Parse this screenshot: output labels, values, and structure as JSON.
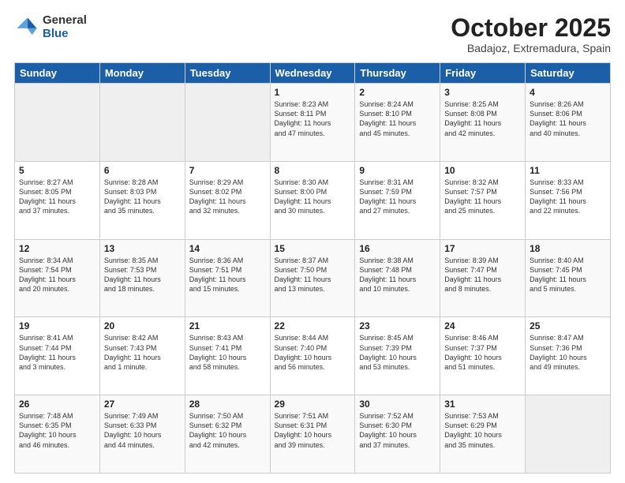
{
  "header": {
    "logo_general": "General",
    "logo_blue": "Blue",
    "month": "October 2025",
    "location": "Badajoz, Extremadura, Spain"
  },
  "weekdays": [
    "Sunday",
    "Monday",
    "Tuesday",
    "Wednesday",
    "Thursday",
    "Friday",
    "Saturday"
  ],
  "weeks": [
    [
      {
        "day": "",
        "info": ""
      },
      {
        "day": "",
        "info": ""
      },
      {
        "day": "",
        "info": ""
      },
      {
        "day": "1",
        "info": "Sunrise: 8:23 AM\nSunset: 8:11 PM\nDaylight: 11 hours\nand 47 minutes."
      },
      {
        "day": "2",
        "info": "Sunrise: 8:24 AM\nSunset: 8:10 PM\nDaylight: 11 hours\nand 45 minutes."
      },
      {
        "day": "3",
        "info": "Sunrise: 8:25 AM\nSunset: 8:08 PM\nDaylight: 11 hours\nand 42 minutes."
      },
      {
        "day": "4",
        "info": "Sunrise: 8:26 AM\nSunset: 8:06 PM\nDaylight: 11 hours\nand 40 minutes."
      }
    ],
    [
      {
        "day": "5",
        "info": "Sunrise: 8:27 AM\nSunset: 8:05 PM\nDaylight: 11 hours\nand 37 minutes."
      },
      {
        "day": "6",
        "info": "Sunrise: 8:28 AM\nSunset: 8:03 PM\nDaylight: 11 hours\nand 35 minutes."
      },
      {
        "day": "7",
        "info": "Sunrise: 8:29 AM\nSunset: 8:02 PM\nDaylight: 11 hours\nand 32 minutes."
      },
      {
        "day": "8",
        "info": "Sunrise: 8:30 AM\nSunset: 8:00 PM\nDaylight: 11 hours\nand 30 minutes."
      },
      {
        "day": "9",
        "info": "Sunrise: 8:31 AM\nSunset: 7:59 PM\nDaylight: 11 hours\nand 27 minutes."
      },
      {
        "day": "10",
        "info": "Sunrise: 8:32 AM\nSunset: 7:57 PM\nDaylight: 11 hours\nand 25 minutes."
      },
      {
        "day": "11",
        "info": "Sunrise: 8:33 AM\nSunset: 7:56 PM\nDaylight: 11 hours\nand 22 minutes."
      }
    ],
    [
      {
        "day": "12",
        "info": "Sunrise: 8:34 AM\nSunset: 7:54 PM\nDaylight: 11 hours\nand 20 minutes."
      },
      {
        "day": "13",
        "info": "Sunrise: 8:35 AM\nSunset: 7:53 PM\nDaylight: 11 hours\nand 18 minutes."
      },
      {
        "day": "14",
        "info": "Sunrise: 8:36 AM\nSunset: 7:51 PM\nDaylight: 11 hours\nand 15 minutes."
      },
      {
        "day": "15",
        "info": "Sunrise: 8:37 AM\nSunset: 7:50 PM\nDaylight: 11 hours\nand 13 minutes."
      },
      {
        "day": "16",
        "info": "Sunrise: 8:38 AM\nSunset: 7:48 PM\nDaylight: 11 hours\nand 10 minutes."
      },
      {
        "day": "17",
        "info": "Sunrise: 8:39 AM\nSunset: 7:47 PM\nDaylight: 11 hours\nand 8 minutes."
      },
      {
        "day": "18",
        "info": "Sunrise: 8:40 AM\nSunset: 7:45 PM\nDaylight: 11 hours\nand 5 minutes."
      }
    ],
    [
      {
        "day": "19",
        "info": "Sunrise: 8:41 AM\nSunset: 7:44 PM\nDaylight: 11 hours\nand 3 minutes."
      },
      {
        "day": "20",
        "info": "Sunrise: 8:42 AM\nSunset: 7:43 PM\nDaylight: 11 hours\nand 1 minute."
      },
      {
        "day": "21",
        "info": "Sunrise: 8:43 AM\nSunset: 7:41 PM\nDaylight: 10 hours\nand 58 minutes."
      },
      {
        "day": "22",
        "info": "Sunrise: 8:44 AM\nSunset: 7:40 PM\nDaylight: 10 hours\nand 56 minutes."
      },
      {
        "day": "23",
        "info": "Sunrise: 8:45 AM\nSunset: 7:39 PM\nDaylight: 10 hours\nand 53 minutes."
      },
      {
        "day": "24",
        "info": "Sunrise: 8:46 AM\nSunset: 7:37 PM\nDaylight: 10 hours\nand 51 minutes."
      },
      {
        "day": "25",
        "info": "Sunrise: 8:47 AM\nSunset: 7:36 PM\nDaylight: 10 hours\nand 49 minutes."
      }
    ],
    [
      {
        "day": "26",
        "info": "Sunrise: 7:48 AM\nSunset: 6:35 PM\nDaylight: 10 hours\nand 46 minutes."
      },
      {
        "day": "27",
        "info": "Sunrise: 7:49 AM\nSunset: 6:33 PM\nDaylight: 10 hours\nand 44 minutes."
      },
      {
        "day": "28",
        "info": "Sunrise: 7:50 AM\nSunset: 6:32 PM\nDaylight: 10 hours\nand 42 minutes."
      },
      {
        "day": "29",
        "info": "Sunrise: 7:51 AM\nSunset: 6:31 PM\nDaylight: 10 hours\nand 39 minutes."
      },
      {
        "day": "30",
        "info": "Sunrise: 7:52 AM\nSunset: 6:30 PM\nDaylight: 10 hours\nand 37 minutes."
      },
      {
        "day": "31",
        "info": "Sunrise: 7:53 AM\nSunset: 6:29 PM\nDaylight: 10 hours\nand 35 minutes."
      },
      {
        "day": "",
        "info": ""
      }
    ]
  ]
}
